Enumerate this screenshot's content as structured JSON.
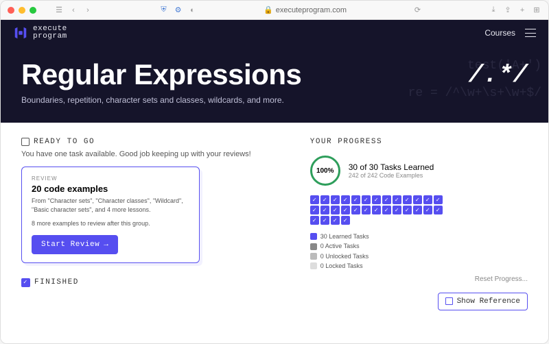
{
  "browser": {
    "url": "executeprogram.com"
  },
  "header": {
    "brand_line1": "execute",
    "brand_line2": "program",
    "nav_courses": "Courses"
  },
  "hero": {
    "title": "Regular Expressions",
    "subtitle": "Boundaries, repetition, character sets and classes, wildcards, and more.",
    "symbol": "/.*/",
    "bg_text": "         test('A+')\n re = /^\\w+\\s+\\w+$/"
  },
  "ready": {
    "heading": "READY TO GO",
    "subtext": "You have one task available. Good job keeping up with your reviews!",
    "card": {
      "tag": "REVIEW",
      "title": "20 code examples",
      "desc": "From \"Character sets\", \"Character classes\", \"Wildcard\", \"Basic character sets\", and 4 more lessons.",
      "note": "8 more examples to review after this group.",
      "button": "Start Review"
    }
  },
  "finished": {
    "heading": "FINISHED"
  },
  "progress": {
    "heading": "YOUR PROGRESS",
    "percent": "100%",
    "tasks_line": "30 of 30 Tasks Learned",
    "examples_line": "242 of 242 Code Examples",
    "grid_count": 30,
    "legend": {
      "learned": "30 Learned Tasks",
      "active": "0 Active Tasks",
      "unlocked": "0 Unlocked Tasks",
      "locked": "0 Locked Tasks"
    },
    "reset": "Reset Progress...",
    "show_reference": "Show Reference"
  }
}
